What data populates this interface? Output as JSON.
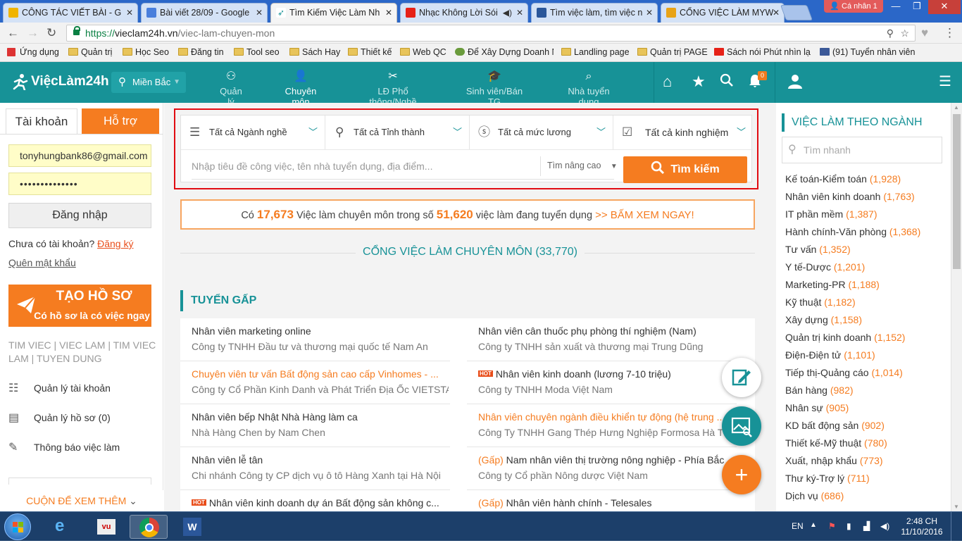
{
  "browser": {
    "tabs": [
      {
        "title": "CÔNG TÁC VIẾT BÀI - G",
        "icon_color": "#f0b400",
        "active": false
      },
      {
        "title": "Bài viết 28/09 - Google",
        "icon_color": "#4a7fdc",
        "active": false
      },
      {
        "title": "Tìm Kiếm Việc Làm Nh",
        "icon_color": "#179297",
        "active": true
      },
      {
        "title": "Nhạc Không Lời Sói",
        "icon_color": "#e62117",
        "active": false
      },
      {
        "title": "Tìm việc làm, tìm việc n",
        "icon_color": "#2b579a",
        "active": false
      },
      {
        "title": "CỔNG VIỆC LÀM MYW",
        "icon_color": "#e8a317",
        "active": false
      }
    ],
    "profile_label": "Cá nhân 1",
    "url_scheme": "https://",
    "url_host": "vieclam24h.vn",
    "url_path": "/viec-lam-chuyen-mon",
    "bookmarks": [
      "Ứng dụng",
      "Quản trị",
      "Học Seo",
      "Đăng tin",
      "Tool seo",
      "Sách Hay",
      "Thiết kế",
      "Web QC",
      "Để Xây Dựng Doanh N",
      "Landling page",
      "Quản trị PAGE",
      "Sách nói Phút nhìn lạ",
      "(91) Tuyển nhân viên"
    ]
  },
  "site": {
    "logo_text": "ViệcLàm24h",
    "location": "Miền Bắc",
    "nav": [
      {
        "label": "Quản lý",
        "icon": "users-icon"
      },
      {
        "label": "Chuyên môn",
        "icon": "person-icon"
      },
      {
        "label": "LĐ Phổ thông/Nghề",
        "icon": "tools-icon"
      },
      {
        "label": "Sinh viên/Bán TG",
        "icon": "graduation-icon"
      },
      {
        "label": "Nhà tuyển dụng",
        "icon": "search-person-icon"
      }
    ],
    "notification_count": "0"
  },
  "left": {
    "tab_account": "Tài khoản",
    "tab_support": "Hỗ trợ",
    "email": "tonyhungbank86@gmail.com",
    "password_mask": "••••••••••••••",
    "login_button": "Đăng nhập",
    "no_account": "Chưa có tài khoản?",
    "register_link": "Đăng ký",
    "forgot_link": "Quên mật khẩu",
    "create_cv_title": "TẠO HỒ SƠ",
    "create_cv_sub": "Có hồ sơ là có việc ngay",
    "tags_line1": "TIM VIEC | VIEC LAM | TIM VIEC",
    "tags_line2": "LAM | TUYEN DUNG",
    "menu": [
      "Quản lý tài khoản",
      "Quản lý hồ sơ (0)",
      "Thông báo việc làm"
    ],
    "scroll_more": "CUỘN ĐỂ XEM THÊM"
  },
  "search": {
    "industry": "Tất cả Ngành nghề",
    "province": "Tất cả Tỉnh thành",
    "salary": "Tất cả mức lương",
    "experience": "Tất cả kinh nghiệm",
    "keyword_placeholder": "Nhập tiêu đề công việc, tên nhà tuyển dụng, địa điểm...",
    "advanced": "Tìm nâng cao",
    "button": "Tìm kiếm"
  },
  "promo": {
    "prefix": "Có",
    "count_specialist": "17,673",
    "middle": "Việc làm chuyên môn trong số",
    "count_total": "51,620",
    "suffix": "việc làm đang tuyển dụng",
    "cta": ">> BẤM XEM NGAY!"
  },
  "gate_title": "CỔNG VIỆC LÀM CHUYÊN MÔN (33,770)",
  "urgent_title": "TUYỂN GẤP",
  "jobs": [
    {
      "title": "Nhân viên marketing online",
      "company": "Công ty TNHH Đầu tư và thương mại quốc tế Nam An",
      "highlight": false,
      "hot": false
    },
    {
      "title": "Nhân viên cân thuốc phụ phòng thí nghiệm (Nam)",
      "company": "Công ty TNHH sản xuất và thương mại Trung Dũng",
      "highlight": false,
      "hot": false
    },
    {
      "title": "Chuyên viên tư vấn Bất động sản cao cấp Vinhomes - ...",
      "company": "Công ty Cổ Phần Kinh Danh và Phát Triển Địa Ốc VIETSTAR...",
      "highlight": true,
      "hot": false
    },
    {
      "title": "Nhân viên kinh doanh (lương 7-10 triệu)",
      "company": "Công ty TNHH Moda Việt Nam",
      "highlight": false,
      "hot": true
    },
    {
      "title": "Nhân viên bếp Nhật Nhà Hàng làm ca",
      "company": "Nhà Hàng Chen by Nam Chen",
      "highlight": false,
      "hot": false
    },
    {
      "title": "Nhân viên chuyên ngành điều khiển tự động (hệ trung ...",
      "company": "Công Ty TNHH Gang Thép Hưng Nghiệp Formosa Hà Tĩnh",
      "highlight": true,
      "hot": false
    },
    {
      "title": "Nhân viên lễ tân",
      "company": "Chi nhánh Công ty CP dịch vụ ô tô Hàng Xanh tại Hà Nội",
      "highlight": false,
      "hot": false
    },
    {
      "title": "(Gấp) Nam nhân viên thị trường nông nghiệp - Phía Bắc",
      "company": "Công ty Cổ phần Nông dược Việt Nam",
      "highlight": false,
      "hot": false,
      "prefix_gap": true
    },
    {
      "title": "Nhân viên kinh doanh dự án Bất động sản không c...",
      "company": "",
      "highlight": false,
      "hot": true
    },
    {
      "title": "(Gấp) Nhân viên hành chính - Telesales",
      "company": "",
      "highlight": false,
      "hot": false,
      "prefix_gap": true
    }
  ],
  "right": {
    "title": "VIỆC LÀM THEO NGÀNH",
    "search_placeholder": "Tìm nhanh",
    "categories": [
      {
        "name": "Kế toán-Kiểm toán",
        "count": "(1,928)"
      },
      {
        "name": "Nhân viên kinh doanh",
        "count": "(1,763)"
      },
      {
        "name": "IT phần mềm",
        "count": "(1,387)"
      },
      {
        "name": "Hành chính-Văn phòng",
        "count": "(1,368)"
      },
      {
        "name": "Tư vấn",
        "count": "(1,352)"
      },
      {
        "name": "Y tế-Dược",
        "count": "(1,201)"
      },
      {
        "name": "Marketing-PR",
        "count": "(1,188)"
      },
      {
        "name": "Kỹ thuật",
        "count": "(1,182)"
      },
      {
        "name": "Xây dựng",
        "count": "(1,158)"
      },
      {
        "name": "Quản trị kinh doanh",
        "count": "(1,152)"
      },
      {
        "name": "Điện-Điện tử",
        "count": "(1,101)"
      },
      {
        "name": "Tiếp thị-Quảng cáo",
        "count": "(1,014)"
      },
      {
        "name": "Bán hàng",
        "count": "(982)"
      },
      {
        "name": "Nhân sự",
        "count": "(905)"
      },
      {
        "name": "KD bất động sản",
        "count": "(902)"
      },
      {
        "name": "Thiết kế-Mỹ thuật",
        "count": "(780)"
      },
      {
        "name": "Xuất, nhập khẩu",
        "count": "(773)"
      },
      {
        "name": "Thư ký-Trợ lý",
        "count": "(711)"
      },
      {
        "name": "Dịch vụ",
        "count": "(686)"
      }
    ]
  },
  "taskbar": {
    "lang": "EN",
    "time": "2:48 CH",
    "date": "11/10/2016"
  },
  "colors": {
    "teal": "#179297",
    "orange": "#f57c20",
    "search_border": "#e10b11"
  }
}
